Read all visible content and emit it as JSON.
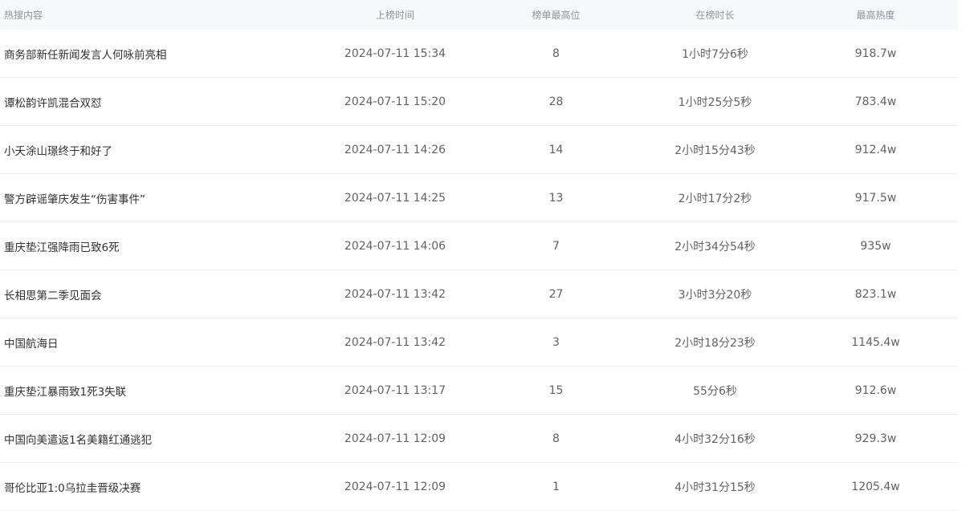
{
  "table": {
    "headers": [
      "热搜内容",
      "上榜时间",
      "榜单最高位",
      "在榜时长",
      "最高热度"
    ],
    "rows": [
      {
        "title": "商务部新任新闻发言人何咏前亮相",
        "time": "2024-07-11 15:34",
        "rank": "8",
        "duration": "1小时7分6秒",
        "heat": "918.7w"
      },
      {
        "title": "谭松韵许凯混合双怼",
        "time": "2024-07-11 15:20",
        "rank": "28",
        "duration": "1小时25分5秒",
        "heat": "783.4w"
      },
      {
        "title": "小夭涂山璟终于和好了",
        "time": "2024-07-11 14:26",
        "rank": "14",
        "duration": "2小时15分43秒",
        "heat": "912.4w"
      },
      {
        "title": "警方辟谣肇庆发生“伤害事件”",
        "time": "2024-07-11 14:25",
        "rank": "13",
        "duration": "2小时17分2秒",
        "heat": "917.5w"
      },
      {
        "title": "重庆垫江强降雨已致6死",
        "time": "2024-07-11 14:06",
        "rank": "7",
        "duration": "2小时34分54秒",
        "heat": "935w"
      },
      {
        "title": "长相思第二季见面会",
        "time": "2024-07-11 13:42",
        "rank": "27",
        "duration": "3小时3分20秒",
        "heat": "823.1w"
      },
      {
        "title": "中国航海日",
        "time": "2024-07-11 13:42",
        "rank": "3",
        "duration": "2小时18分23秒",
        "heat": "1145.4w"
      },
      {
        "title": "重庆垫江暴雨致1死3失联",
        "time": "2024-07-11 13:17",
        "rank": "15",
        "duration": "55分6秒",
        "heat": "912.6w"
      },
      {
        "title": "中国向美遣返1名美籍红通逃犯",
        "time": "2024-07-11 12:09",
        "rank": "8",
        "duration": "4小时32分16秒",
        "heat": "929.3w"
      },
      {
        "title": "哥伦比亚1:0乌拉圭晋级决赛",
        "time": "2024-07-11 12:09",
        "rank": "1",
        "duration": "4小时31分15秒",
        "heat": "1205.4w"
      }
    ]
  }
}
